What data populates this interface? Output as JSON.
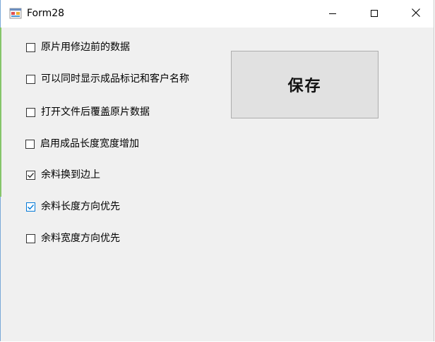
{
  "window": {
    "title": "Form28"
  },
  "checkboxes": [
    {
      "label": "原片用修边前的数据",
      "checked": false
    },
    {
      "label": "可以同时显示成品标记和客户名称",
      "checked": false
    },
    {
      "label": "打开文件后覆盖原片数据",
      "checked": false
    },
    {
      "label": "启用成品长度宽度增加",
      "checked": false
    },
    {
      "label": "余料换到边上",
      "checked": true
    },
    {
      "label": "余料长度方向优先",
      "checked": true
    },
    {
      "label": "余料宽度方向优先",
      "checked": false
    }
  ],
  "save_button": {
    "label": "保存"
  },
  "icons": {
    "app": "form-app-icon",
    "minimize": "minimize-icon",
    "maximize": "maximize-icon",
    "close": "close-icon",
    "check": "checkmark-icon"
  },
  "colors": {
    "window_bg": "#f0f0f0",
    "titlebar_bg": "#ffffff",
    "accent_blue": "#0078d7",
    "button_bg": "#e1e1e1"
  }
}
